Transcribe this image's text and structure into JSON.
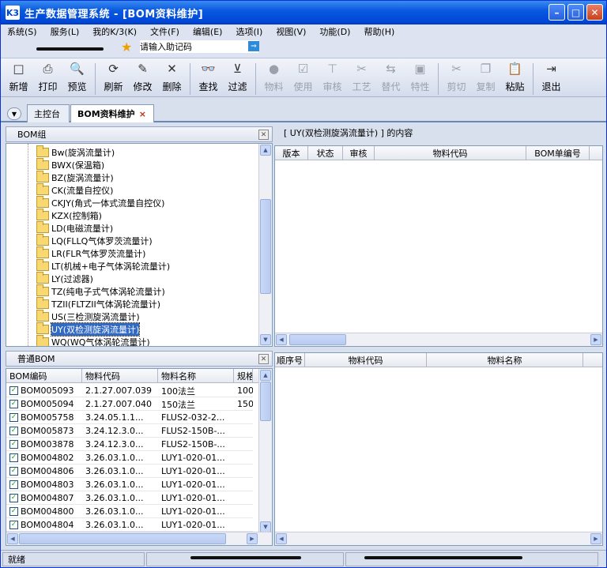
{
  "window": {
    "title": "生产数据管理系统 - [BOM资料维护]",
    "app_icon": "K3"
  },
  "menu": [
    "系统(S)",
    "服务(L)",
    "我的K/3(K)",
    "文件(F)",
    "编辑(E)",
    "选项(I)",
    "视图(V)",
    "功能(D)",
    "帮助(H)"
  ],
  "quick": {
    "placeholder": "请输入助记码",
    "go": "⇒"
  },
  "toolbar": [
    {
      "label": "新增",
      "icon": "new-icon",
      "glyph": "□",
      "enabled": true
    },
    {
      "label": "打印",
      "icon": "print-icon",
      "glyph": "⎙",
      "enabled": true
    },
    {
      "label": "预览",
      "icon": "preview-icon",
      "glyph": "🔍",
      "enabled": true
    },
    {
      "label": "刷新",
      "icon": "refresh-icon",
      "glyph": "⟳",
      "enabled": true
    },
    {
      "label": "修改",
      "icon": "edit-icon",
      "glyph": "✎",
      "enabled": true
    },
    {
      "label": "删除",
      "icon": "delete-icon",
      "glyph": "✕",
      "enabled": true
    },
    {
      "label": "查找",
      "icon": "find-icon",
      "glyph": "👓",
      "enabled": true
    },
    {
      "label": "过滤",
      "icon": "filter-icon",
      "glyph": "⊻",
      "enabled": true
    },
    {
      "label": "物料",
      "icon": "material-icon",
      "glyph": "●",
      "enabled": false
    },
    {
      "label": "使用",
      "icon": "use-icon",
      "glyph": "☑",
      "enabled": false
    },
    {
      "label": "审核",
      "icon": "audit-icon",
      "glyph": "⊤",
      "enabled": false
    },
    {
      "label": "工艺",
      "icon": "process-icon",
      "glyph": "✂",
      "enabled": false
    },
    {
      "label": "替代",
      "icon": "substitute-icon",
      "glyph": "⇆",
      "enabled": false
    },
    {
      "label": "特性",
      "icon": "feature-icon",
      "glyph": "▣",
      "enabled": false
    },
    {
      "label": "剪切",
      "icon": "cut-icon",
      "glyph": "✂",
      "enabled": false
    },
    {
      "label": "复制",
      "icon": "copy-icon",
      "glyph": "❐",
      "enabled": false
    },
    {
      "label": "粘贴",
      "icon": "paste-icon",
      "glyph": "📋",
      "enabled": true
    },
    {
      "label": "退出",
      "icon": "exit-icon",
      "glyph": "⇥",
      "enabled": true
    }
  ],
  "tabs": {
    "main": "主控台",
    "bom": "BOM资料维护",
    "close": "×"
  },
  "bom_group": {
    "title": "BOM组",
    "items": [
      "Bw(旋涡流量计)",
      "BWX(保温箱)",
      "BZ(旋涡流量计)",
      "CK(流量自控仪)",
      "CKJY(角式一体式流量自控仪)",
      "KZX(控制箱)",
      "LD(电磁流量计)",
      "LQ(FLLQ气体罗茨流量计)",
      "LR(FLR气体罗茨流量计)",
      "LT(机械+电子气体涡轮流量计)",
      "LY(过滤器)",
      "TZ(纯电子式气体涡轮流量计)",
      "TZII(FLTZII气体涡轮流量计)",
      "US(三检测旋涡流量计)",
      "UY(双检测旋涡流量计)",
      "WQ(WQ气体涡轮流量计)"
    ],
    "selected_index": 14
  },
  "content": {
    "caption": "[ UY(双检测旋涡流量计) ] 的内容",
    "columns": [
      "版本",
      "状态",
      "审核",
      "物料代码",
      "BOM单编号"
    ]
  },
  "normal_bom": {
    "title": "普通BOM",
    "columns": [
      "BOM编码",
      "物料代码",
      "物料名称",
      "规格"
    ],
    "rows": [
      {
        "code": "BOM005093",
        "material": "2.1.27.007.039",
        "name": "100法兰",
        "spec": "100"
      },
      {
        "code": "BOM005094",
        "material": "2.1.27.007.040",
        "name": "150法兰",
        "spec": "150"
      },
      {
        "code": "BOM005758",
        "material": "3.24.05.1.1...",
        "name": "FLUS2-032-2...",
        "spec": ""
      },
      {
        "code": "BOM005873",
        "material": "3.24.12.3.0...",
        "name": "FLUS2-150B-...",
        "spec": ""
      },
      {
        "code": "BOM003878",
        "material": "3.24.12.3.0...",
        "name": "FLUS2-150B-...",
        "spec": ""
      },
      {
        "code": "BOM004802",
        "material": "3.26.03.1.0...",
        "name": "LUY1-020-01...",
        "spec": ""
      },
      {
        "code": "BOM004806",
        "material": "3.26.03.1.0...",
        "name": "LUY1-020-01...",
        "spec": ""
      },
      {
        "code": "BOM004803",
        "material": "3.26.03.1.0...",
        "name": "LUY1-020-01...",
        "spec": ""
      },
      {
        "code": "BOM004807",
        "material": "3.26.03.1.0...",
        "name": "LUY1-020-01...",
        "spec": ""
      },
      {
        "code": "BOM004800",
        "material": "3.26.03.1.0...",
        "name": "LUY1-020-01...",
        "spec": ""
      },
      {
        "code": "BOM004804",
        "material": "3.26.03.1.0...",
        "name": "LUY1-020-01...",
        "spec": ""
      }
    ]
  },
  "detail": {
    "columns": [
      "顺序号",
      "物料代码",
      "物料名称"
    ]
  },
  "status": {
    "text": "就绪"
  }
}
